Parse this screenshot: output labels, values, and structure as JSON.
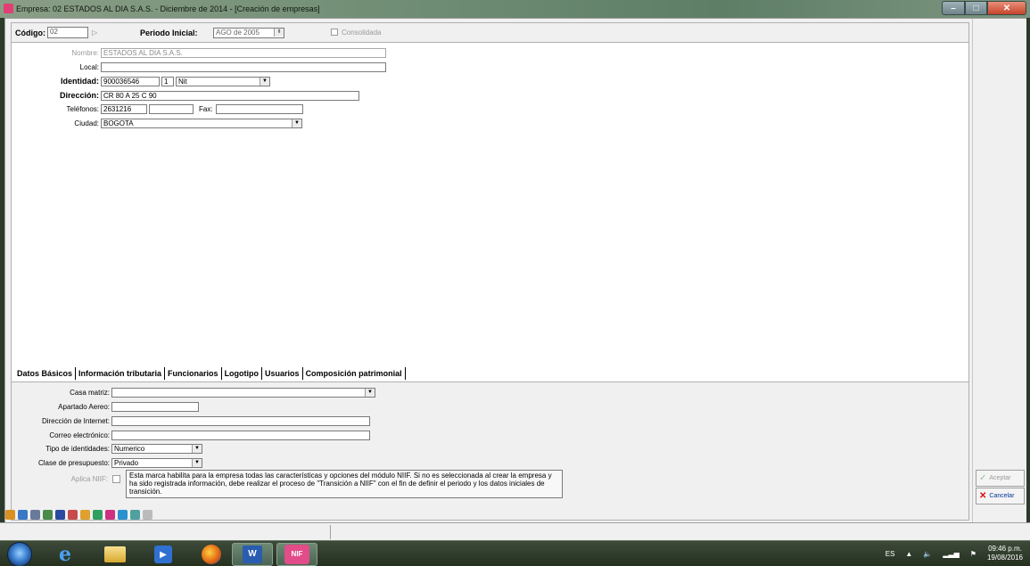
{
  "window": {
    "title": "Empresa: 02 ESTADOS AL DIA S.A.S. - Diciembre de 2014 - [Creación de empresas]"
  },
  "header": {
    "codigo_label": "Código:",
    "codigo_value": "02",
    "periodo_label": "Periodo Inicial:",
    "periodo_value": "AGO de 2005",
    "consolidada_label": "Consolidada"
  },
  "general": {
    "nombre_label": "Nombre:",
    "nombre_value": "ESTADOS AL DIA S.A.S.",
    "local_label": "Local:",
    "local_value": "",
    "identidad_label": "Identidad:",
    "identidad_value": "900036546",
    "identidad_dv": "1",
    "identidad_tipo": "Nit",
    "direccion_label": "Dirección:",
    "direccion_value": "CR 80 A  25 C 90",
    "telefonos_label": "Teléfonos:",
    "telefono1": "2631216",
    "telefono2": "",
    "fax_label": "Fax:",
    "fax_value": "",
    "ciudad_label": "Ciudad:",
    "ciudad_value": "BOGOTA"
  },
  "tabs": [
    {
      "label": "Datos Básicos"
    },
    {
      "label": "Información tributaria"
    },
    {
      "label": "Funcionarios"
    },
    {
      "label": "Logotipo"
    },
    {
      "label": "Usuarios"
    },
    {
      "label": "Composición patrimonial"
    }
  ],
  "basicos": {
    "casa_matriz_label": "Casa matriz:",
    "casa_matriz_value": "",
    "apartado_label": "Apartado Aereo:",
    "apartado_value": "",
    "direccion_internet_label": "Dirección de Internet:",
    "direccion_internet_value": "",
    "correo_label": "Correo electrónico:",
    "correo_value": "",
    "tipo_identidades_label": "Tipo de identidades:",
    "tipo_identidades_value": "Numerico",
    "clase_presupuesto_label": "Clase de presupuesto:",
    "clase_presupuesto_value": "Privado",
    "aplica_niif_label": "Aplica NIIF:",
    "niif_note": "Esta marca habilita para la empresa todas las características y opciones del módulo NIIF. Si no es seleccionada al crear la empresa y ha sido registrada información, debe realizar el proceso de \"Transición a NIIF\" con el fin de definir el periodo y los datos iniciales de transición."
  },
  "actions": {
    "aceptar_label": "Aceptar",
    "cancelar_label": "Cancelar"
  },
  "taskbar": {
    "language": "ES",
    "time": "09:46 p.m.",
    "date": "19/08/2016"
  }
}
